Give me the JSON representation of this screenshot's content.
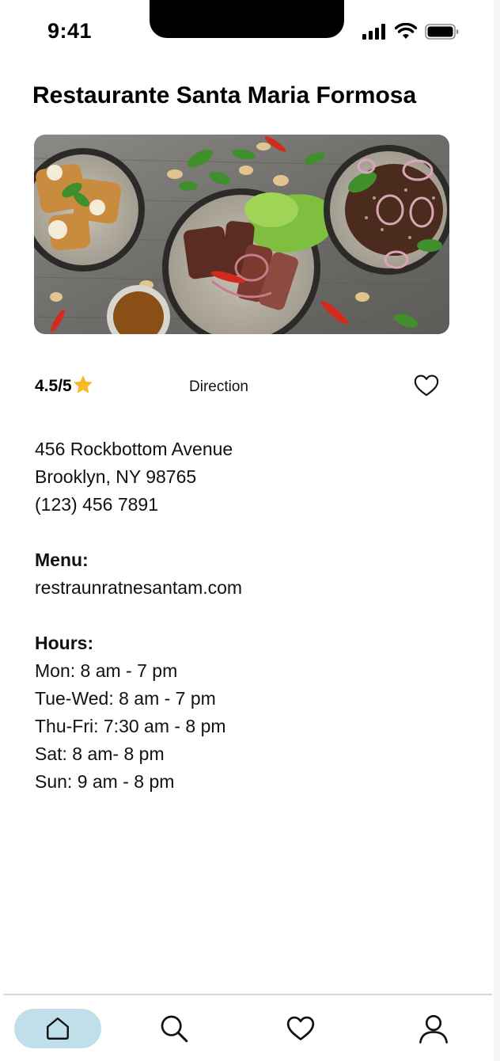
{
  "status_bar": {
    "time": "9:41",
    "icons": [
      "cellular-signal-icon",
      "wifi-icon",
      "battery-icon"
    ]
  },
  "restaurant": {
    "name": "Restaurante Santa Maria Formosa",
    "image": "food-photo",
    "rating": "4.5/5",
    "rating_icon": "star-icon",
    "direction_label": "Direction",
    "favorite_icon": "heart-outline-icon"
  },
  "address": {
    "street": "456 Rockbottom Avenue",
    "city": "Brooklyn, NY 98765",
    "phone": "(123) 456 7891"
  },
  "menu": {
    "heading": "Menu:",
    "url": "restraunratnesantam.com"
  },
  "hours": {
    "heading": "Hours:",
    "lines": [
      "Mon: 8 am - 7 pm",
      "Tue-Wed: 8 am - 7 pm",
      "Thu-Fri: 7:30 am - 8 pm",
      "Sat: 8 am- 8 pm",
      "Sun: 9 am - 8 pm"
    ]
  },
  "bottom_nav": {
    "items": [
      {
        "name": "home",
        "icon": "home-icon",
        "active": true
      },
      {
        "name": "search",
        "icon": "search-icon",
        "active": false
      },
      {
        "name": "favorites",
        "icon": "heart-icon",
        "active": false
      },
      {
        "name": "profile",
        "icon": "user-icon",
        "active": false
      }
    ]
  },
  "colors": {
    "active_nav_bg": "#bfe0ea",
    "star": "#f7b928",
    "divider": "#d9d9d9"
  }
}
